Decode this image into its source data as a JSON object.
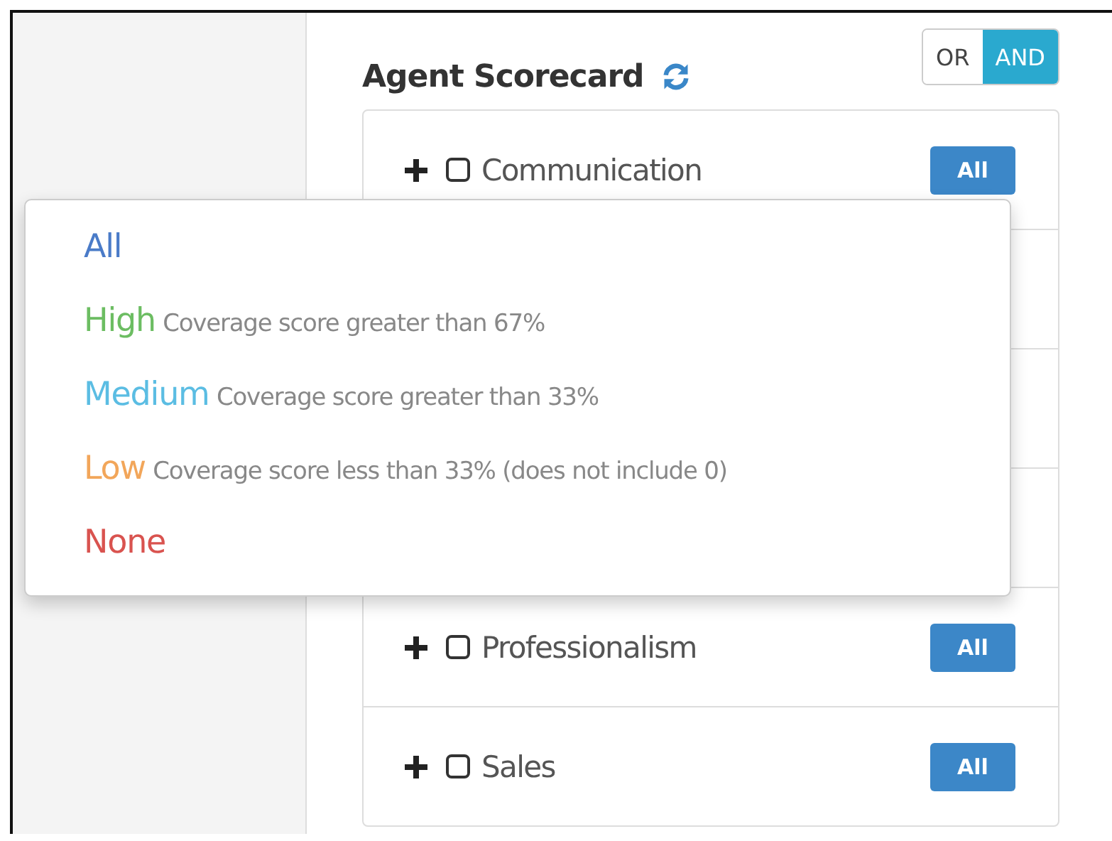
{
  "panel": {
    "title": "Agent Scorecard",
    "logic_toggle": [
      {
        "label": "OR",
        "selected": false
      },
      {
        "label": "AND",
        "selected": true
      }
    ]
  },
  "categories": [
    {
      "kind": "category",
      "label": "Communication",
      "badge": "All",
      "checked": false
    },
    {
      "kind": "covered"
    },
    {
      "kind": "covered"
    },
    {
      "kind": "covered"
    },
    {
      "kind": "category",
      "label": "Professionalism",
      "badge": "All",
      "checked": false
    },
    {
      "kind": "category",
      "label": "Sales",
      "badge": "All",
      "checked": false
    }
  ],
  "filter_menu": [
    {
      "label": "All",
      "color": "#4a7bc8"
    },
    {
      "label": "High",
      "description": "Coverage score greater than 67%",
      "color": "#6cbd62"
    },
    {
      "label": "Medium",
      "description": "Coverage score greater than 33%",
      "color": "#5bbde3"
    },
    {
      "label": "Low",
      "description": "Coverage score less than 33% (does not include 0)",
      "color": "#f2a65a"
    },
    {
      "label": "None",
      "color": "#d9534f"
    }
  ]
}
